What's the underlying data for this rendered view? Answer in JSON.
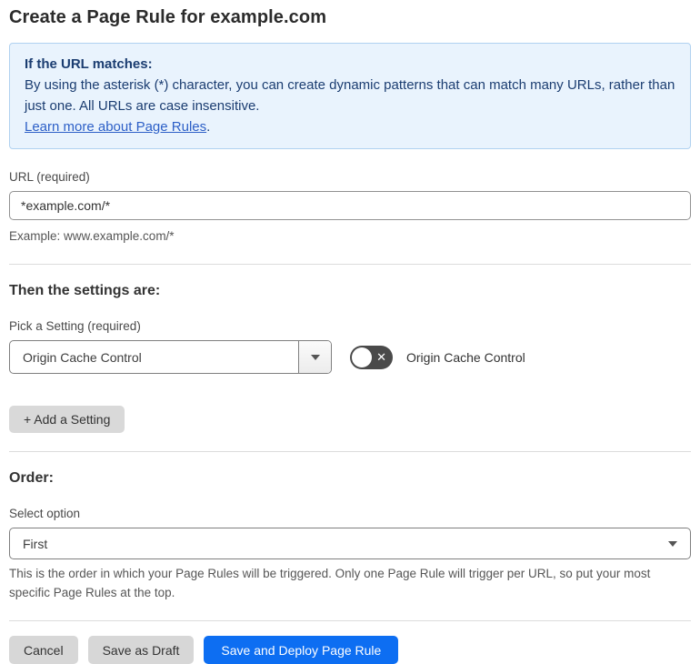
{
  "page": {
    "title": "Create a Page Rule for example.com"
  },
  "info_box": {
    "heading": "If the URL matches:",
    "body": "By using the asterisk (*) character, you can create dynamic patterns that can match many URLs, rather than just one. All URLs are case insensitive.",
    "link_label": "Learn more about Page Rules",
    "link_suffix": "."
  },
  "url_field": {
    "label": "URL (required)",
    "value": "*example.com/*",
    "helper": "Example: www.example.com/*"
  },
  "settings_section": {
    "heading": "Then the settings are:",
    "setting_label": "Pick a Setting (required)",
    "setting_value": "Origin Cache Control",
    "toggle_label": "Origin Cache Control",
    "toggle_state": "off",
    "add_setting_label": "+ Add a Setting"
  },
  "order_section": {
    "heading": "Order:",
    "select_label": "Select option",
    "select_value": "First",
    "helper": "This is the order in which your Page Rules will be triggered. Only one Page Rule will trigger per URL, so put your most specific Page Rules at the top."
  },
  "footer": {
    "cancel_label": "Cancel",
    "save_draft_label": "Save as Draft",
    "save_deploy_label": "Save and Deploy Page Rule"
  },
  "icons": {
    "toggle_off_glyph": "✕"
  },
  "colors": {
    "info_bg": "#e9f3fd",
    "info_border": "#b0d1f0",
    "info_text": "#1b3d71",
    "link_blue": "#2c5fc7",
    "primary_blue": "#0d6ef2",
    "button_gray": "#d7d7d7",
    "toggle_off_bg": "#4a4a4a"
  }
}
